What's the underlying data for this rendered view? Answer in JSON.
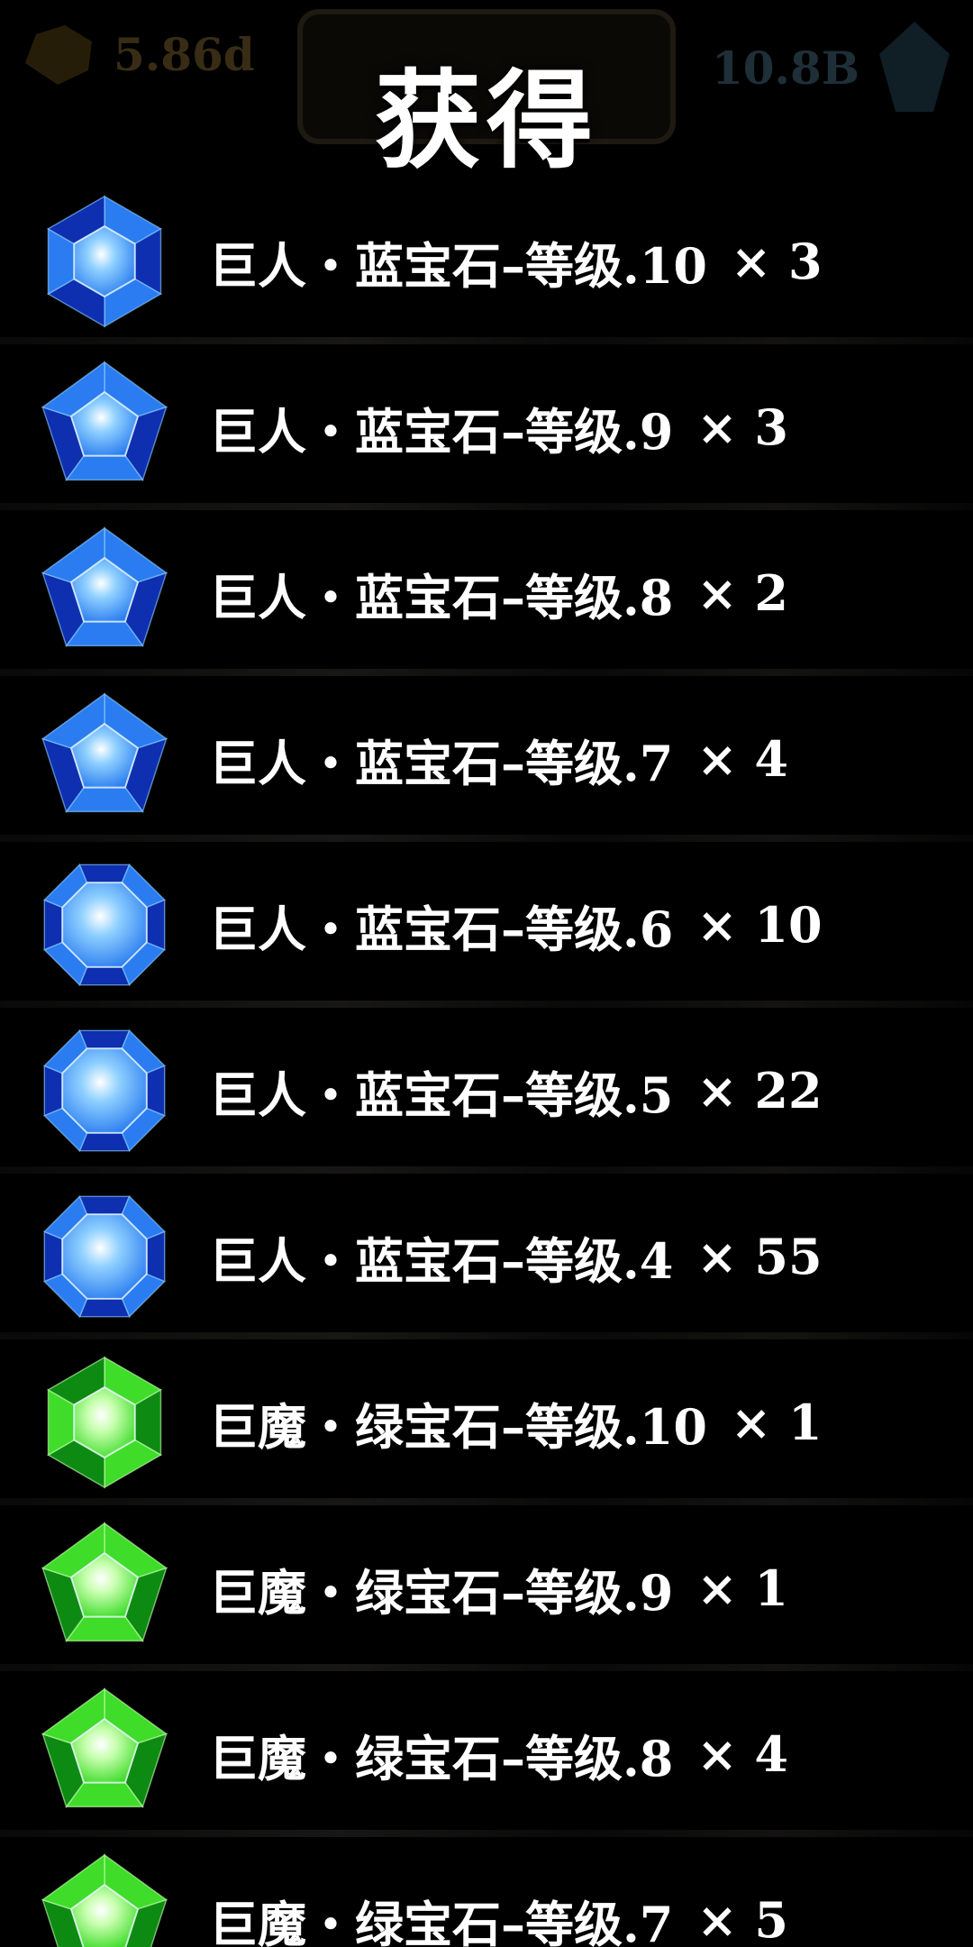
{
  "title": "获得",
  "hud": {
    "gold": "5.86d",
    "crystal": "10.8B"
  },
  "items": [
    {
      "name": "巨人・蓝宝石–等级.10",
      "qty": "× 3",
      "color": "blue",
      "shape": "hexagon"
    },
    {
      "name": "巨人・蓝宝石–等级.9",
      "qty": "× 3",
      "color": "blue",
      "shape": "pentagon"
    },
    {
      "name": "巨人・蓝宝石–等级.8",
      "qty": "× 2",
      "color": "blue",
      "shape": "pentagon"
    },
    {
      "name": "巨人・蓝宝石–等级.7",
      "qty": "× 4",
      "color": "blue",
      "shape": "pentagon"
    },
    {
      "name": "巨人・蓝宝石–等级.6",
      "qty": "× 10",
      "color": "blue",
      "shape": "octagon"
    },
    {
      "name": "巨人・蓝宝石–等级.5",
      "qty": "× 22",
      "color": "blue",
      "shape": "octagon"
    },
    {
      "name": "巨人・蓝宝石–等级.4",
      "qty": "× 55",
      "color": "blue",
      "shape": "octagon"
    },
    {
      "name": "巨魔・绿宝石–等级.10",
      "qty": "× 1",
      "color": "green",
      "shape": "hexagon"
    },
    {
      "name": "巨魔・绿宝石–等级.9",
      "qty": "× 1",
      "color": "green",
      "shape": "pentagon"
    },
    {
      "name": "巨魔・绿宝石–等级.8",
      "qty": "× 4",
      "color": "green",
      "shape": "pentagon"
    },
    {
      "name": "巨魔・绿宝石–等级.7",
      "qty": "× 5",
      "color": "green",
      "shape": "pentagon"
    }
  ],
  "colors": {
    "blue": {
      "light": "#8fd0ff",
      "mid": "#2a7cf0",
      "dark": "#0d2fb0"
    },
    "green": {
      "light": "#c8ffb0",
      "mid": "#3fdc2a",
      "dark": "#0d8a12"
    }
  }
}
